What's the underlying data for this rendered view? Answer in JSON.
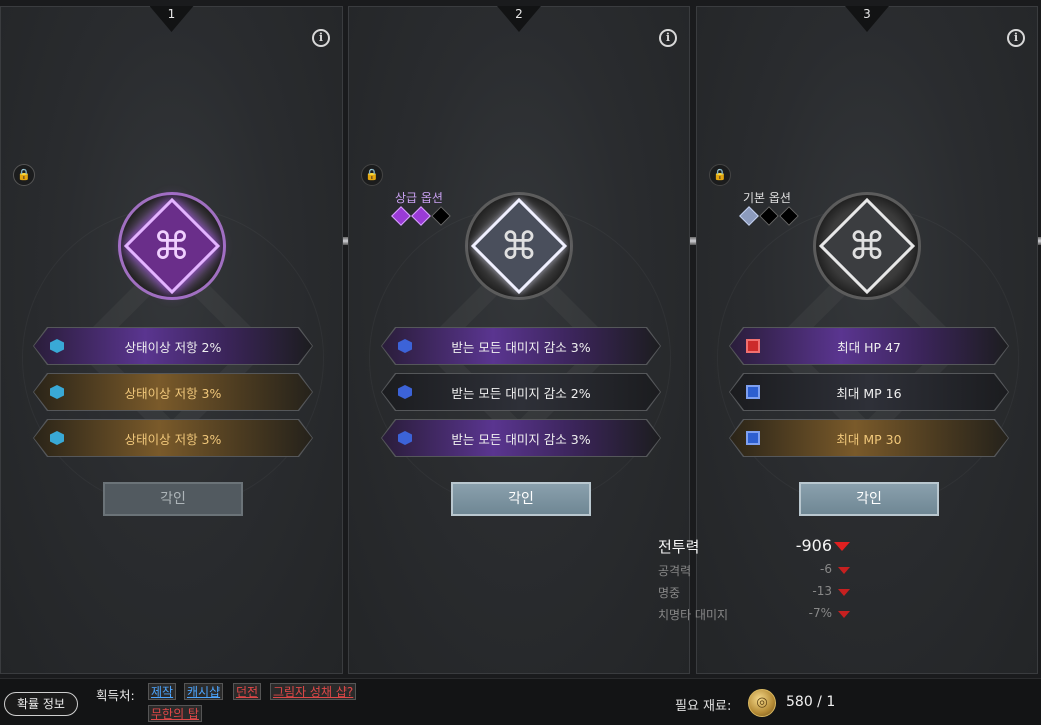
{
  "panels": [
    {
      "number": "1",
      "grade_label": "",
      "lock_icon": "lock-icon",
      "options": [
        {
          "text": "상태이상 저항 2%",
          "style": "purple",
          "icon": "hex"
        },
        {
          "text": "상태이상 저항 3%",
          "style": "orange",
          "icon": "hex"
        },
        {
          "text": "상태이상 저항 3%",
          "style": "orange",
          "icon": "hex"
        }
      ],
      "button_label": "각인",
      "button_enabled": false
    },
    {
      "number": "2",
      "grade_label": "상급 옵션",
      "options": [
        {
          "text": "받는 모든 대미지 감소 3%",
          "style": "purple",
          "icon": "hex-blue"
        },
        {
          "text": "받는 모든 대미지 감소 2%",
          "style": "dark",
          "icon": "hex-blue"
        },
        {
          "text": "받는 모든 대미지 감소 3%",
          "style": "purple",
          "icon": "hex-blue"
        }
      ],
      "button_label": "각인",
      "button_enabled": true
    },
    {
      "number": "3",
      "grade_label": "기본 옵션",
      "options": [
        {
          "text": "최대 HP 47",
          "style": "purple",
          "icon": "square-red"
        },
        {
          "text": "최대 MP 16",
          "style": "dark",
          "icon": "square-blue"
        },
        {
          "text": "최대 MP 30",
          "style": "orange",
          "icon": "square-blue"
        }
      ],
      "button_label": "각인",
      "button_enabled": true
    }
  ],
  "stats": {
    "combat_power": {
      "label": "전투력",
      "value": "-906"
    },
    "rows": [
      {
        "label": "공격력",
        "value": "-6"
      },
      {
        "label": "명중",
        "value": "-13"
      },
      {
        "label": "치명타 대미지",
        "value": "-7%"
      }
    ]
  },
  "bottom": {
    "probability_button": "확률 정보",
    "source_label": "획득처:",
    "sources": [
      {
        "text": "제작",
        "color": "blue"
      },
      {
        "text": "캐시샵",
        "color": "blue"
      },
      {
        "text": "던전",
        "color": "red"
      },
      {
        "text": "그림자 성채 샵?",
        "color": "red"
      },
      {
        "text": "무한의 탑",
        "color": "red"
      }
    ],
    "material_label": "필요 재료:",
    "material_count": "580 / 1"
  },
  "colors": {
    "purple_accent": "#9a3bd6",
    "gold_text": "#f0c77a",
    "down_red": "#e02020",
    "link_blue": "#4da6ff",
    "link_red": "#e04848"
  }
}
